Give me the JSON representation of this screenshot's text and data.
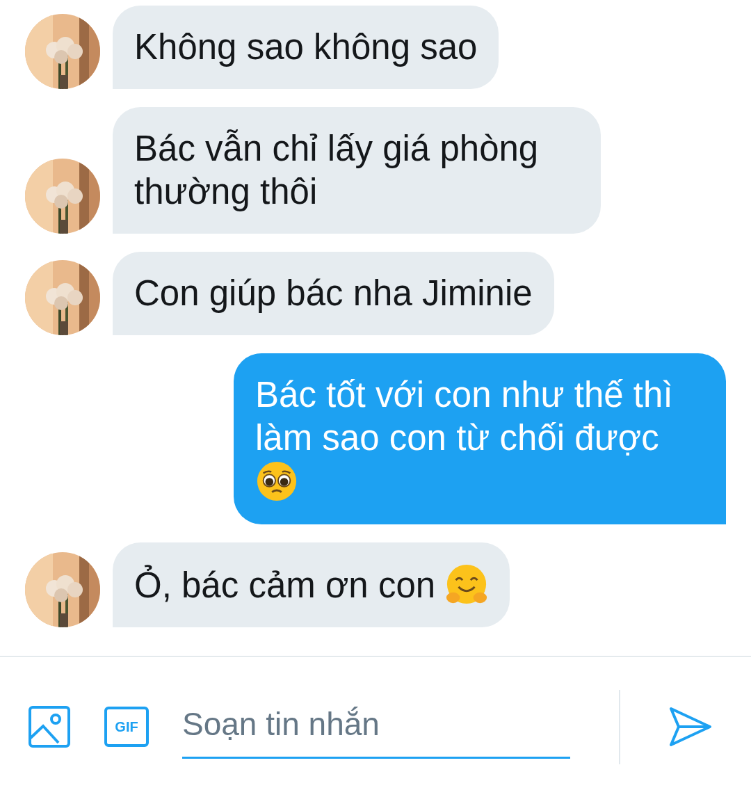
{
  "messages": [
    {
      "kind": "incoming",
      "text": "Không sao không sao"
    },
    {
      "kind": "incoming",
      "text": "Bác vẫn chỉ lấy giá phòng thường thôi"
    },
    {
      "kind": "incoming",
      "text": "Con giúp bác nha Jiminie"
    },
    {
      "kind": "outgoing",
      "text": "Bác tốt với con như thế thì làm sao con từ chối được",
      "emoji": {
        "kind": "pleading"
      }
    },
    {
      "kind": "incoming",
      "text": "Ỏ, bác cảm ơn con",
      "emoji": {
        "kind": "hugging"
      }
    }
  ],
  "composer": {
    "placeholder": "Soạn tin nhắn",
    "gif_label": "GIF"
  }
}
